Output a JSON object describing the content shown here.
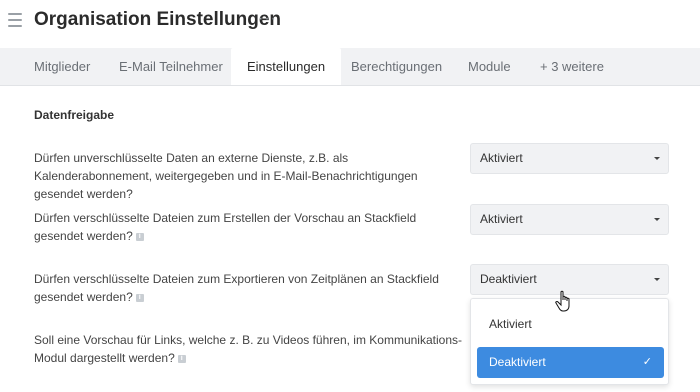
{
  "header": {
    "title": "Organisation Einstellungen",
    "more": "···"
  },
  "tabs": [
    {
      "label": "Mitglieder"
    },
    {
      "label": "E-Mail Teilnehmer"
    },
    {
      "label": "Einstellungen"
    },
    {
      "label": "Berechtigungen"
    },
    {
      "label": "Module"
    },
    {
      "label": "+ 3 weitere"
    }
  ],
  "section": {
    "title": "Datenfreigabe"
  },
  "settings": [
    {
      "question": "Dürfen unverschlüsselte Daten an externe Dienste, z.B. als Kalenderabonnement, weitergegeben und in E-Mail-Benachrichtigungen gesendet werden?",
      "value": "Aktiviert"
    },
    {
      "question": "Dürfen verschlüsselte Dateien zum Erstellen der Vorschau an Stackfield gesendet werden?",
      "value": "Aktiviert"
    },
    {
      "question": "Dürfen verschlüsselte Dateien zum Exportieren von Zeitplänen an Stackfield gesendet werden?",
      "value": "Deaktiviert"
    },
    {
      "question": "Soll eine Vorschau für Links, welche z. B. zu Videos führen, im Kommunikations-Modul dargestellt werden?"
    }
  ],
  "dropdown": {
    "options": [
      {
        "label": "Aktiviert"
      },
      {
        "label": "Deaktiviert"
      }
    ],
    "check": "✓"
  },
  "info_icon": "i",
  "colors": {
    "accent": "#3d8be0",
    "tabbar": "#f1f2f4",
    "select_bg": "#f1f2f4"
  }
}
